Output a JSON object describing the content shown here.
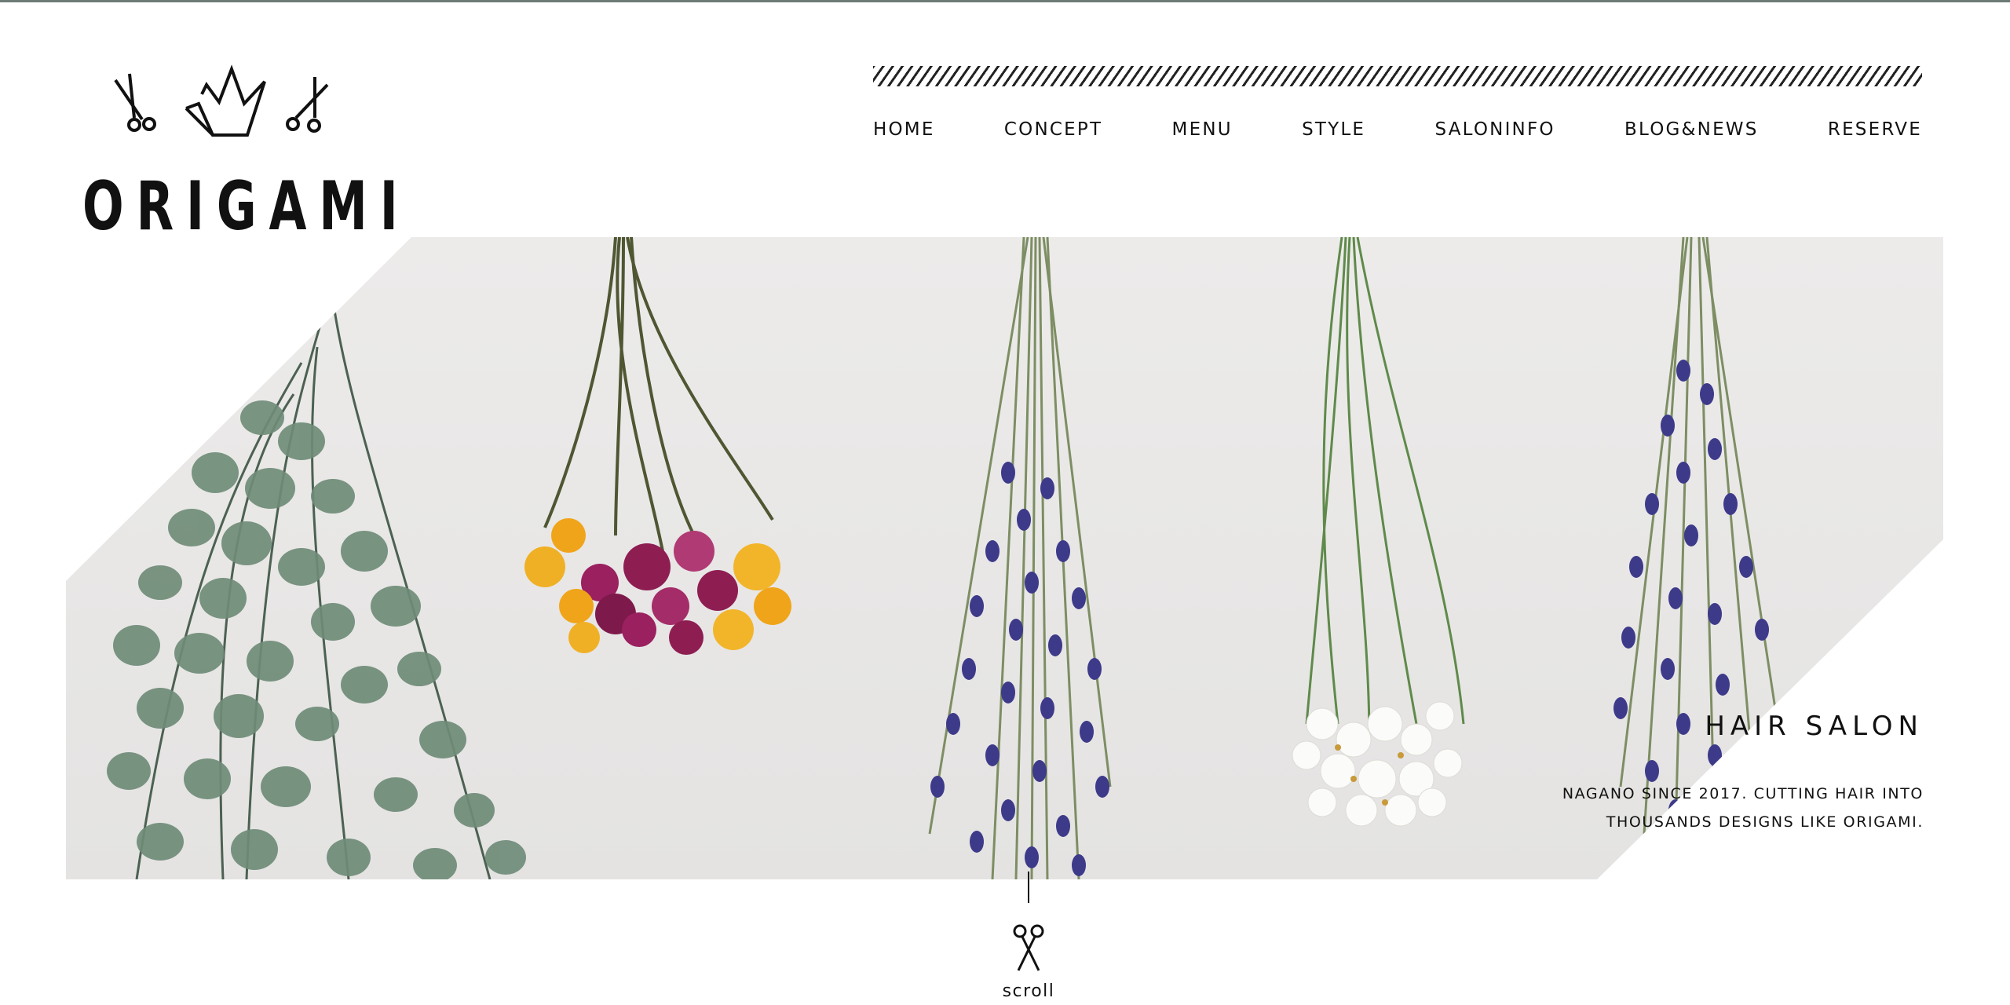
{
  "brand": {
    "name": "ORIGAMI",
    "logo_icons": [
      "scissors-icon",
      "crown-icon",
      "scissors-icon"
    ]
  },
  "nav": {
    "items": [
      {
        "label": "HOME"
      },
      {
        "label": "CONCEPT"
      },
      {
        "label": "MENU"
      },
      {
        "label": "STYLE"
      },
      {
        "label": "SALONINFO"
      },
      {
        "label": "BLOG&NEWS"
      },
      {
        "label": "RESERVE"
      }
    ]
  },
  "hero": {
    "title": "HAIR SALON",
    "body": "NAGANO SINCE 2017. CUTTING HAIR INTO THOUSANDS DESIGNS LIKE ORIGAMI.",
    "image_subject": "dried flower bundles hanging on a white wall"
  },
  "scroll": {
    "label": "scroll",
    "icon": "scissors-icon"
  },
  "colors": {
    "top_rule": "#6d7b76",
    "text": "#111111",
    "wall": "#e9e8e7",
    "lavender": "#3e3a8a",
    "eucalyptus": "#6f8c78",
    "strawflower_orange": "#f0a419",
    "strawflower_magenta": "#8e1e52"
  }
}
